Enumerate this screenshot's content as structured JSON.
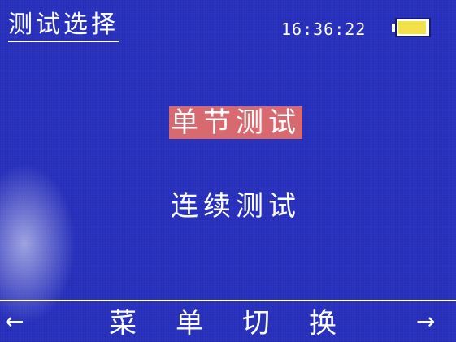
{
  "header": {
    "title": "测试选择",
    "time": "16:36:22",
    "battery_icon": "battery-icon",
    "battery_level": 0.95,
    "battery_fill_color": "#f2e14a"
  },
  "menu": {
    "items": [
      {
        "label": "单节测试",
        "selected": true
      },
      {
        "label": "连续测试",
        "selected": false
      }
    ],
    "selected_color": "#d86a6f"
  },
  "footer": {
    "left_arrow": "←",
    "right_arrow": "→",
    "hint": "菜单切换"
  },
  "colors": {
    "background": "#2a33c2",
    "text": "#ffffff"
  }
}
